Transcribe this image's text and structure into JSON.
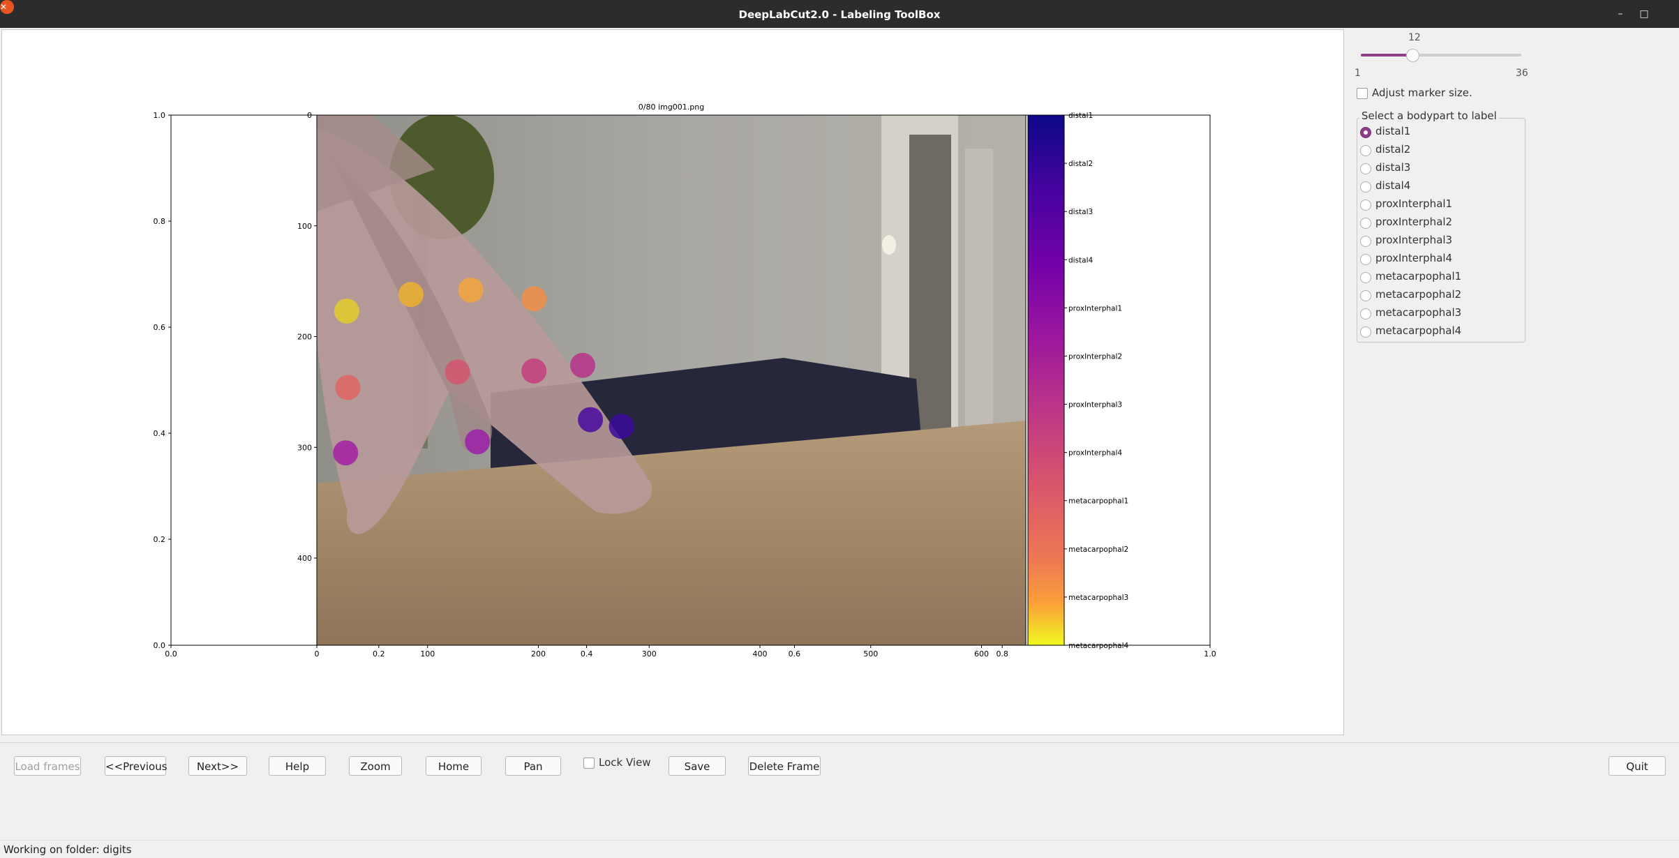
{
  "window": {
    "title": "DeepLabCut2.0 - Labeling ToolBox"
  },
  "figure": {
    "image_title": "0/80 img001.png",
    "outer_axis": {
      "y_ticks": [
        "1.0",
        "0.8",
        "0.6",
        "0.4",
        "0.2",
        "0.0"
      ],
      "x_ticks": [
        "0.0",
        "0.2",
        "0.4",
        "0.6",
        "0.8",
        "1.0"
      ]
    },
    "image_axis": {
      "y_ticks": [
        "0",
        "100",
        "200",
        "300",
        "400"
      ],
      "x_ticks": [
        "0",
        "100",
        "200",
        "300",
        "400",
        "500",
        "600"
      ]
    },
    "colormap": "plasma",
    "colorbar_labels": [
      "distal1",
      "distal2",
      "distal3",
      "distal4",
      "proxInterphal1",
      "proxInterphal2",
      "proxInterphal3",
      "proxInterphal4",
      "metacarpophal1",
      "metacarpophal2",
      "metacarpophal3",
      "metacarpophal4"
    ],
    "markers": [
      {
        "bodypart": "proxInterphal1",
        "x": 26,
        "y": 305,
        "color": "#a21fa3"
      },
      {
        "bodypart": "proxInterphal2",
        "x": 145,
        "y": 295,
        "color": "#9a1fa8"
      },
      {
        "bodypart": "distal1",
        "x": 247,
        "y": 275,
        "color": "#4b0aa0"
      },
      {
        "bodypart": "distal2",
        "x": 275,
        "y": 281,
        "color": "#3a0a9a"
      },
      {
        "bodypart": "proxInterphal3",
        "x": 28,
        "y": 246,
        "color": "#e16462"
      },
      {
        "bodypart": "proxInterphal4",
        "x": 127,
        "y": 232,
        "color": "#d5546d"
      },
      {
        "bodypart": "distal3",
        "x": 196,
        "y": 231,
        "color": "#c43d7d"
      },
      {
        "bodypart": "distal4",
        "x": 240,
        "y": 226,
        "color": "#b7318a"
      },
      {
        "bodypart": "metacarpophal3",
        "x": 27,
        "y": 177,
        "color": "#e1cc2a"
      },
      {
        "bodypart": "metacarpophal2",
        "x": 85,
        "y": 162,
        "color": "#edb02d"
      },
      {
        "bodypart": "metacarpophal1",
        "x": 139,
        "y": 158,
        "color": "#f3a43a"
      },
      {
        "bodypart": "metacarpophal4",
        "x": 196,
        "y": 166,
        "color": "#f28e44"
      }
    ]
  },
  "sidebar": {
    "slider": {
      "value": "12",
      "min": "1",
      "max": "36",
      "level": 0.31
    },
    "adjust_marker_label": "Adjust marker size.",
    "bodypart_group_title": "Select a bodypart to label",
    "selected_bodypart": "distal1",
    "bodyparts": [
      "distal1",
      "distal2",
      "distal3",
      "distal4",
      "proxInterphal1",
      "proxInterphal2",
      "proxInterphal3",
      "proxInterphal4",
      "metacarpophal1",
      "metacarpophal2",
      "metacarpophal3",
      "metacarpophal4"
    ]
  },
  "toolbar": {
    "load_frames": "Load frames",
    "previous": "<<Previous",
    "next": "Next>>",
    "help": "Help",
    "zoom": "Zoom",
    "home": "Home",
    "pan": "Pan",
    "lock_view": "Lock View",
    "save": "Save",
    "delete_frame": "Delete Frame",
    "quit": "Quit"
  },
  "status": {
    "text": "Working on folder: digits"
  },
  "colors": {
    "accent": "#8e3f8b",
    "close": "#e95420"
  }
}
